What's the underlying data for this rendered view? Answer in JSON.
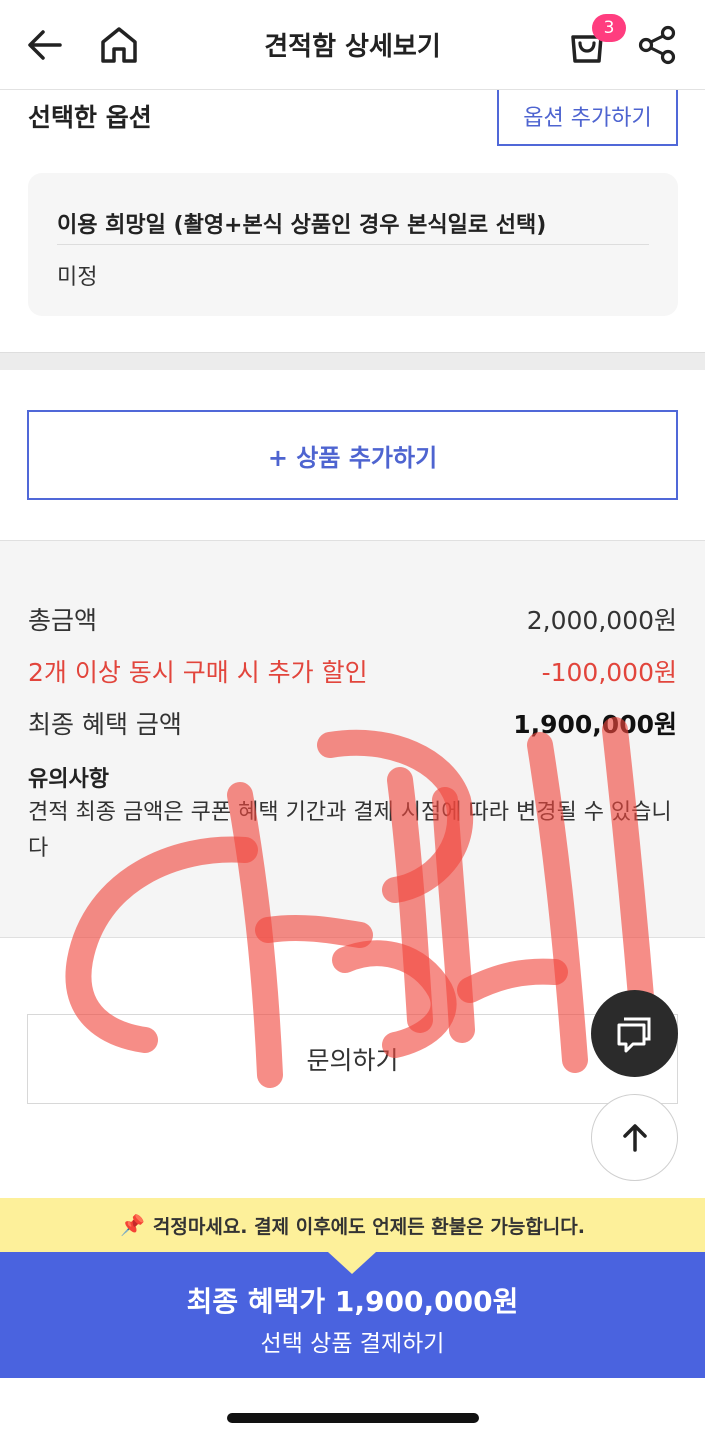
{
  "header": {
    "title": "견적함 상세보기",
    "cart_count": "3",
    "icons": [
      "back-arrow-icon",
      "home-icon",
      "shopping-bag-icon",
      "share-icon"
    ]
  },
  "options": {
    "heading": "선택한 옵션",
    "add_button": "옵션 추가하기",
    "item_label": "이용 희망일 (촬영+본식 상품인 경우 본식일로 선택)",
    "item_value": "미정"
  },
  "add_product_label": "+ 상품 추가하기",
  "summary": {
    "total_label": "총금액",
    "total_value": "2,000,000원",
    "discount_label": "2개 이상 동시 구매 시 추가 할인",
    "discount_value": "-100,000원",
    "final_label": "최종 혜택 금액",
    "final_value": "1,900,000원",
    "notice_title": "유의사항",
    "notice_body": "견적 최종 금액은 쿠폰 혜택 기간과 결제 시점에 따라 변경될 수 있습니다"
  },
  "inquiry_label": "문의하기",
  "banner_text": "걱정마세요. 결제 이후에도 언제든 환불은 가능합니다.",
  "pay": {
    "price_text": "최종 혜택가 1,900,000원",
    "action_text": "선택 상품 결제하기"
  },
  "colors": {
    "accent": "#4a63df",
    "discount_red": "#e2453c",
    "banner_yellow": "#fdf09a",
    "badge_pink": "#ff3d7f"
  }
}
